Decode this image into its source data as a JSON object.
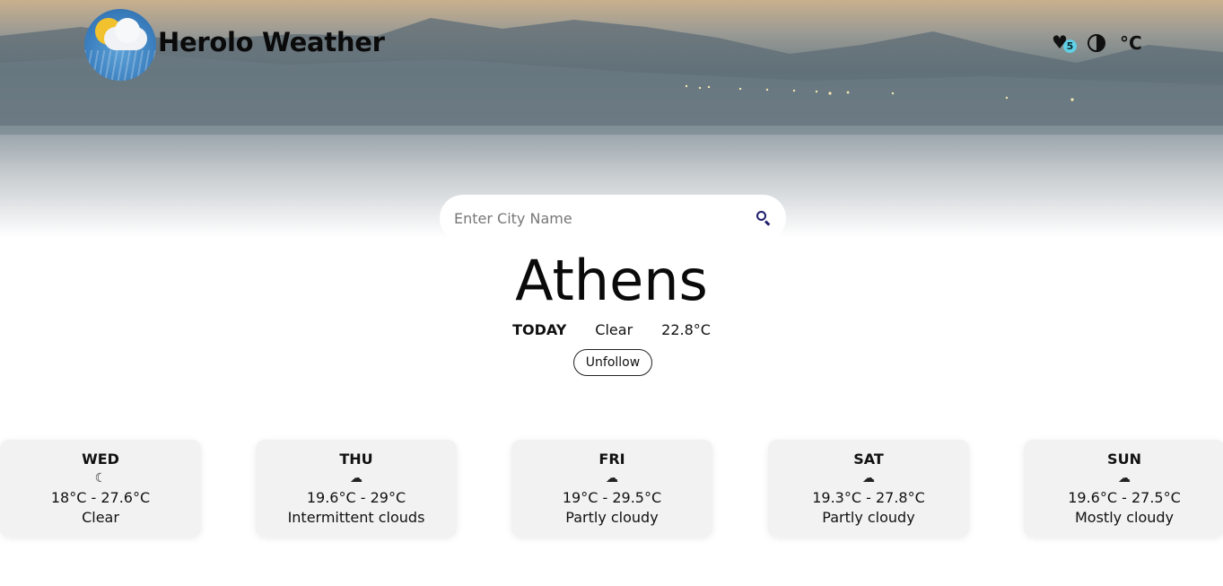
{
  "header": {
    "brand": "Herolo Weather",
    "favorites_count": "5",
    "unit_label": "°C"
  },
  "search": {
    "placeholder": "Enter City Name",
    "value": ""
  },
  "current": {
    "city": "Athens",
    "today_label": "TODAY",
    "condition": "Clear",
    "temperature": "22.8°C",
    "follow_button": "Unfollow"
  },
  "forecast": [
    {
      "day": "WED",
      "icon": "moon-icon",
      "range": "18°C - 27.6°C",
      "desc": "Clear"
    },
    {
      "day": "THU",
      "icon": "cloud-icon",
      "range": "19.6°C - 29°C",
      "desc": "Intermittent clouds"
    },
    {
      "day": "FRI",
      "icon": "cloud-icon",
      "range": "19°C - 29.5°C",
      "desc": "Partly cloudy"
    },
    {
      "day": "SAT",
      "icon": "cloud-icon",
      "range": "19.3°C - 27.8°C",
      "desc": "Partly cloudy"
    },
    {
      "day": "SUN",
      "icon": "cloud-icon",
      "range": "19.6°C - 27.5°C",
      "desc": "Mostly cloudy"
    }
  ],
  "colors": {
    "badge": "#5fd0e6",
    "search_icon": "#1c1c6b",
    "card_bg": "#f2f2f2"
  }
}
